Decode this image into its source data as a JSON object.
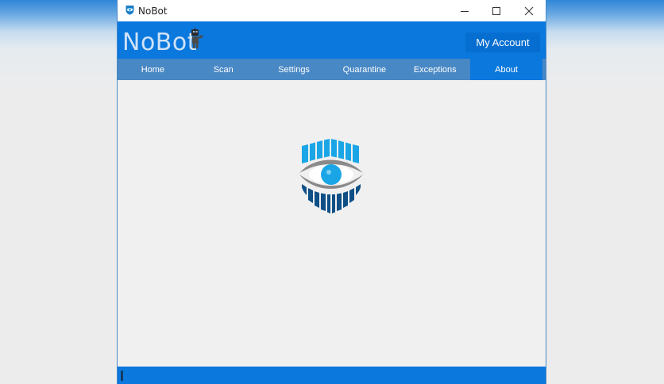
{
  "window": {
    "title": "NoBot"
  },
  "header": {
    "logo_text": "NoBot",
    "account_button": "My Account"
  },
  "nav": {
    "items": [
      {
        "label": "Home"
      },
      {
        "label": "Scan"
      },
      {
        "label": "Settings"
      },
      {
        "label": "Quarantine"
      },
      {
        "label": "Exceptions"
      },
      {
        "label": "About"
      }
    ],
    "active": "About"
  },
  "colors": {
    "brand_blue": "#0b78dd",
    "nav_blue": "#4888c4",
    "shield_light": "#1aa6e6",
    "shield_dark": "#0e4f86",
    "eye_gray": "#8a8a8a"
  }
}
